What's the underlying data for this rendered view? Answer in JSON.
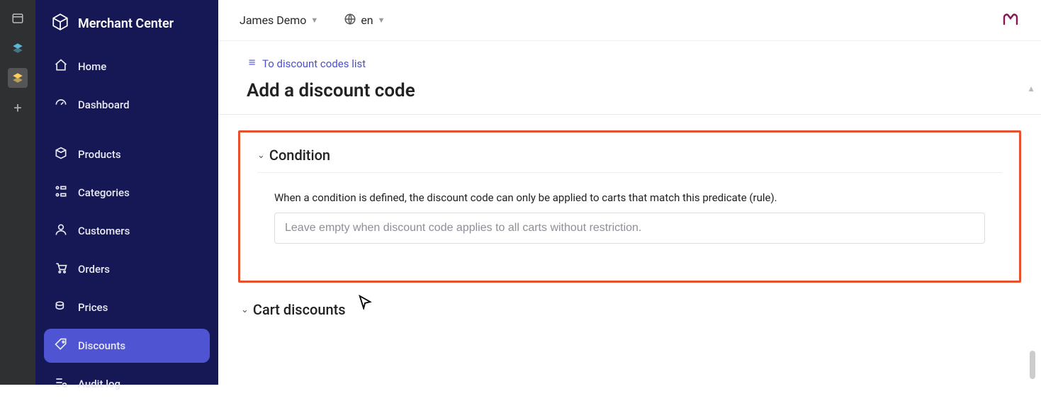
{
  "brand": "Merchant Center",
  "rail": {
    "plus": "+"
  },
  "topbar": {
    "project": "James Demo",
    "locale": "en"
  },
  "sidebar": {
    "group1": [
      {
        "key": "home",
        "label": "Home"
      },
      {
        "key": "dashboard",
        "label": "Dashboard"
      }
    ],
    "group2": [
      {
        "key": "products",
        "label": "Products"
      },
      {
        "key": "categories",
        "label": "Categories"
      },
      {
        "key": "customers",
        "label": "Customers"
      },
      {
        "key": "orders",
        "label": "Orders"
      },
      {
        "key": "prices",
        "label": "Prices"
      },
      {
        "key": "discounts",
        "label": "Discounts"
      },
      {
        "key": "auditlog",
        "label": "Audit log"
      }
    ],
    "active": "discounts"
  },
  "breadcrumb": {
    "back_label": "To discount codes list"
  },
  "page": {
    "title": "Add a discount code"
  },
  "condition": {
    "title": "Condition",
    "help": "When a condition is defined, the discount code can only be applied to carts that match this predicate (rule).",
    "placeholder": "Leave empty when discount code applies to all carts without restriction."
  },
  "cart_discounts": {
    "title": "Cart discounts"
  }
}
